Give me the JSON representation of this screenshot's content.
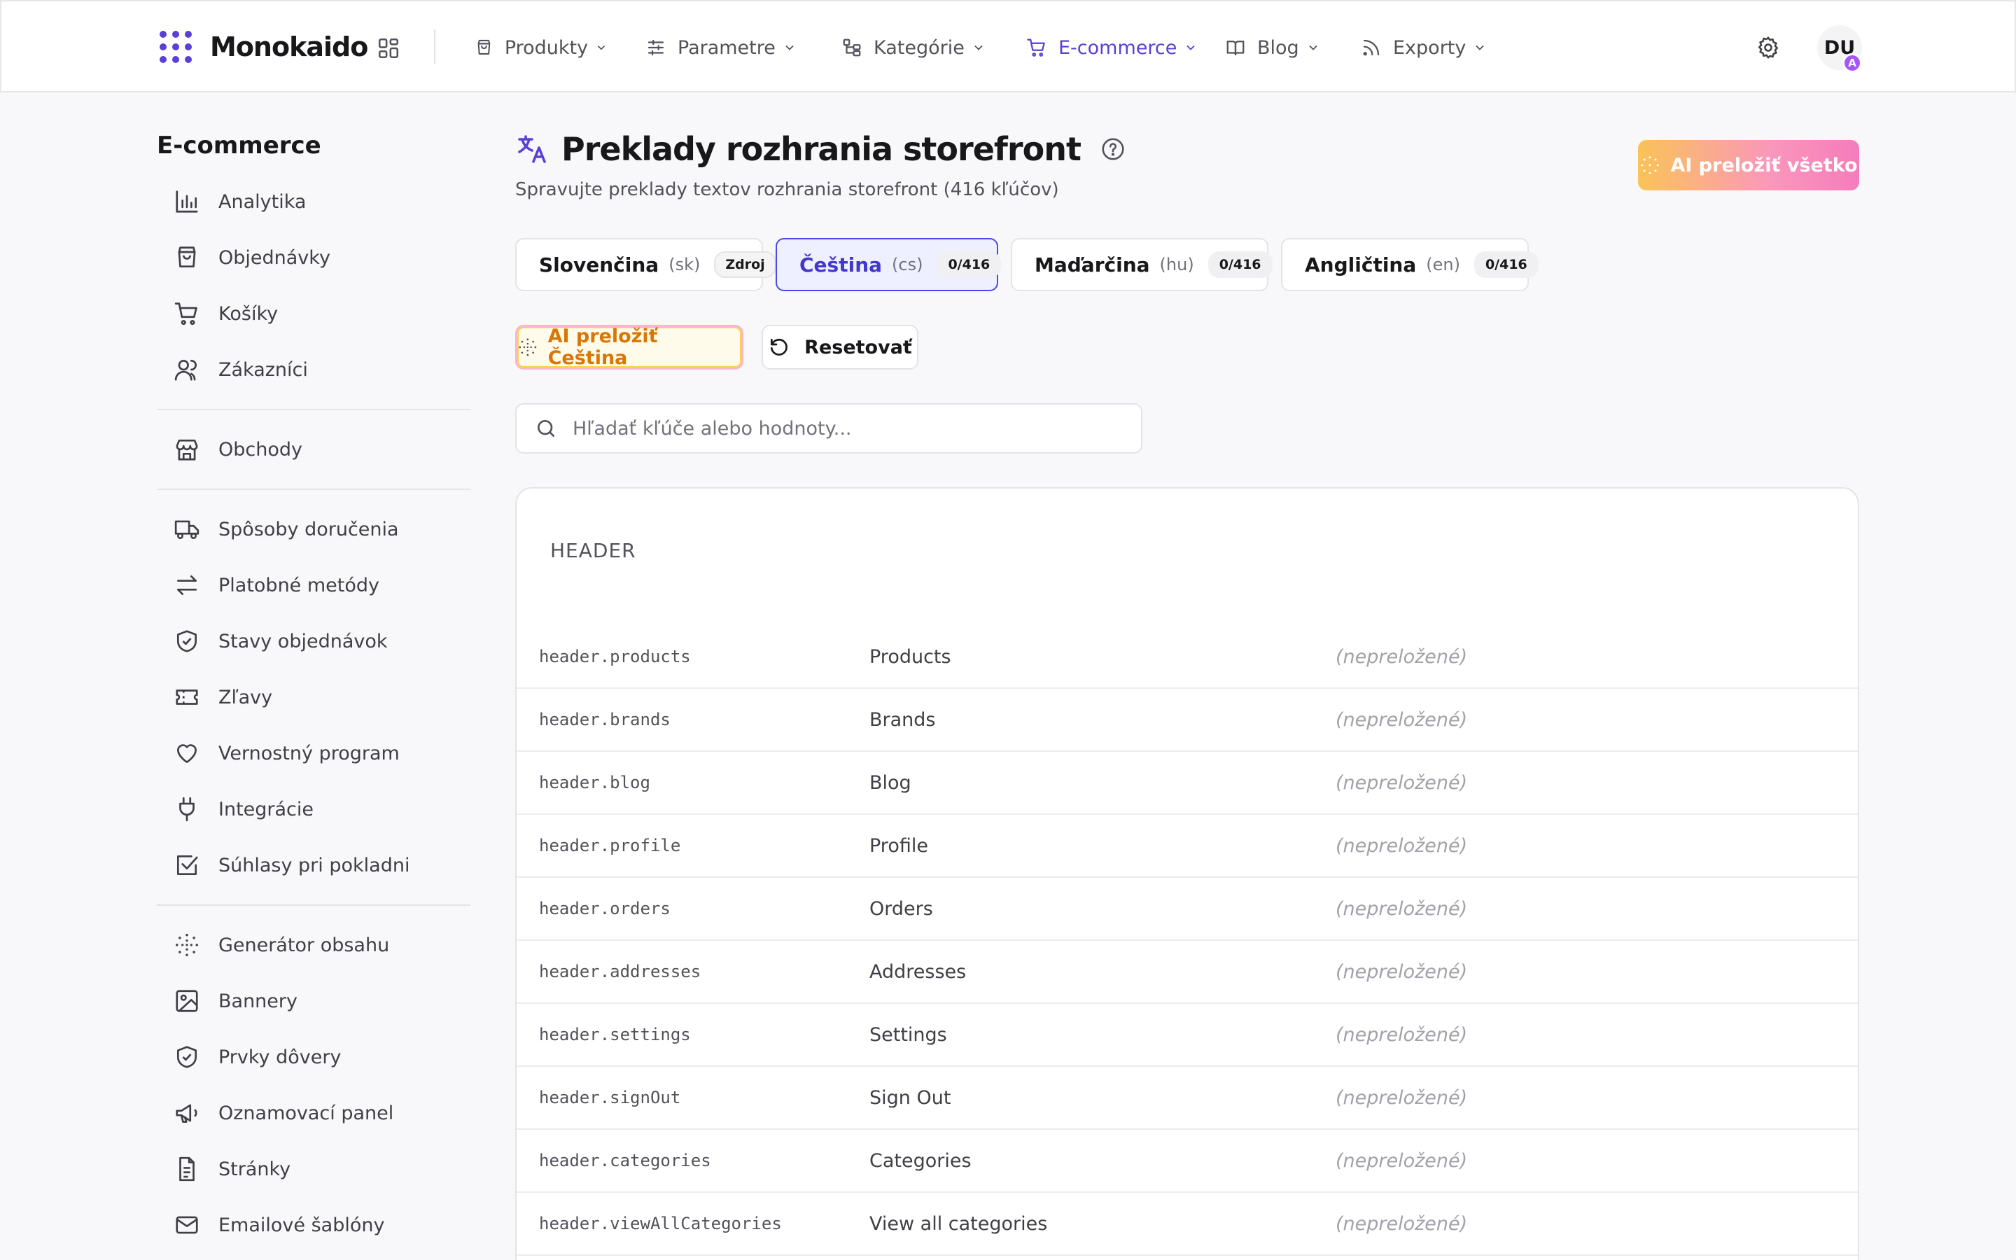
{
  "app": {
    "name": "Monokaido",
    "user_initials": "DU",
    "user_badge": "A",
    "accent_color": "#5b3fd6"
  },
  "nav": {
    "items": [
      {
        "label": "Produkty",
        "icon": "shopping-bag-icon",
        "active": false
      },
      {
        "label": "Parametre",
        "icon": "sliders-icon",
        "active": false
      },
      {
        "label": "Kategórie",
        "icon": "hierarchy-icon",
        "active": false
      },
      {
        "label": "E-commerce",
        "icon": "cart-icon",
        "active": true
      },
      {
        "label": "Blog",
        "icon": "book-icon",
        "active": false
      },
      {
        "label": "Exporty",
        "icon": "rss-icon",
        "active": false
      }
    ]
  },
  "sidebar": {
    "title": "E-commerce",
    "groups": [
      [
        {
          "label": "Analytika",
          "icon": "bar-chart-icon"
        },
        {
          "label": "Objednávky",
          "icon": "shopping-bag-icon"
        },
        {
          "label": "Košíky",
          "icon": "cart-icon"
        },
        {
          "label": "Zákazníci",
          "icon": "users-icon"
        }
      ],
      [
        {
          "label": "Obchody",
          "icon": "store-icon"
        }
      ],
      [
        {
          "label": "Spôsoby doručenia",
          "icon": "truck-icon"
        },
        {
          "label": "Platobné metódy",
          "icon": "arrows-exchange-icon"
        },
        {
          "label": "Stavy objednávok",
          "icon": "shield-check-icon"
        },
        {
          "label": "Zľavy",
          "icon": "ticket-icon"
        },
        {
          "label": "Vernostný program",
          "icon": "heart-icon"
        },
        {
          "label": "Integrácie",
          "icon": "plug-icon"
        },
        {
          "label": "Súhlasy pri pokladni",
          "icon": "checkbox-icon"
        }
      ],
      [
        {
          "label": "Generátor obsahu",
          "icon": "sparkle-dots-icon"
        },
        {
          "label": "Bannery",
          "icon": "image-icon"
        },
        {
          "label": "Prvky dôvery",
          "icon": "shield-check-icon"
        },
        {
          "label": "Oznamovací panel",
          "icon": "megaphone-icon"
        },
        {
          "label": "Stránky",
          "icon": "file-text-icon"
        },
        {
          "label": "Emailové šablóny",
          "icon": "mail-icon"
        }
      ]
    ]
  },
  "page": {
    "title": "Preklady rozhrania storefront",
    "subtitle": "Spravujte preklady textov rozhrania storefront (416 kľúčov)",
    "ai_translate_all": "AI preložiť všetko",
    "ai_translate_lang": "AI preložiť Čeština",
    "reset": "Resetovať",
    "search_placeholder": "Hľadať kľúče alebo hodnoty..."
  },
  "languages": [
    {
      "name": "Slovenčina",
      "code": "(sk)",
      "badge": "Zdroj",
      "active": false
    },
    {
      "name": "Čeština",
      "code": "(cs)",
      "badge": "0/416",
      "active": true
    },
    {
      "name": "Maďarčina",
      "code": "(hu)",
      "badge": "0/416",
      "active": false
    },
    {
      "name": "Angličtina",
      "code": "(en)",
      "badge": "0/416",
      "active": false
    }
  ],
  "section": {
    "title": "HEADER",
    "rows": [
      {
        "key": "header.products",
        "source": "Products",
        "value": "(nepreložené)"
      },
      {
        "key": "header.brands",
        "source": "Brands",
        "value": "(nepreložené)"
      },
      {
        "key": "header.blog",
        "source": "Blog",
        "value": "(nepreložené)"
      },
      {
        "key": "header.profile",
        "source": "Profile",
        "value": "(nepreložené)"
      },
      {
        "key": "header.orders",
        "source": "Orders",
        "value": "(nepreložené)"
      },
      {
        "key": "header.addresses",
        "source": "Addresses",
        "value": "(nepreložené)"
      },
      {
        "key": "header.settings",
        "source": "Settings",
        "value": "(nepreložené)"
      },
      {
        "key": "header.signOut",
        "source": "Sign Out",
        "value": "(nepreložené)"
      },
      {
        "key": "header.categories",
        "source": "Categories",
        "value": "(nepreložené)"
      },
      {
        "key": "header.viewAllCategories",
        "source": "View all categories",
        "value": "(nepreložené)"
      }
    ]
  }
}
